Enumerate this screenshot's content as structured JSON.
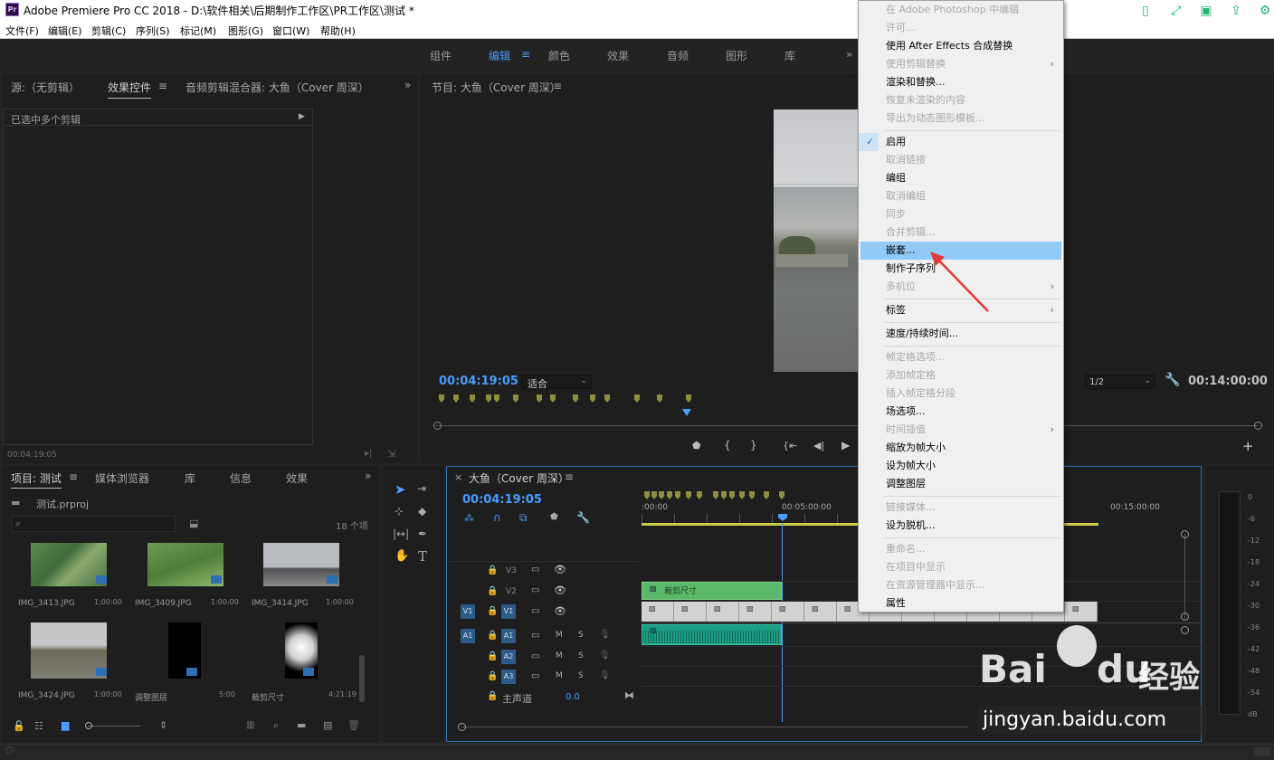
{
  "window": {
    "title": "Adobe Premiere Pro CC 2018 - D:\\软件相关\\后期制作工作区\\PR工作区\\测试 *",
    "logo": "Pr"
  },
  "menubar": [
    "文件(F)",
    "编辑(E)",
    "剪辑(C)",
    "序列(S)",
    "标记(M)",
    "图形(G)",
    "窗口(W)",
    "帮助(H)"
  ],
  "workspaces": [
    "组件",
    "编辑",
    "颜色",
    "效果",
    "音频",
    "图形",
    "库"
  ],
  "source_panel": {
    "tabs": [
      "源:（无剪辑）",
      "效果控件",
      "音频剪辑混合器: 大鱼（Cover 周深）"
    ],
    "selection_label": "已选中多个剪辑",
    "timecode": "00:04:19:05"
  },
  "program": {
    "title": "节目: 大鱼（Cover 周深）",
    "timecode": "00:04:19:05",
    "fit": "适合",
    "resolution": "1/2",
    "duration": "00:14:00:00"
  },
  "project": {
    "tabs": [
      "项目: 测试",
      "媒体浏览器",
      "库",
      "信息",
      "效果"
    ],
    "file": "测试.prproj",
    "count": "18 个项",
    "items": [
      {
        "name": "IMG_3413.JPG",
        "dur": "1:00:00"
      },
      {
        "name": "IMG_3409.JPG",
        "dur": "1:00:00"
      },
      {
        "name": "IMG_3414.JPG",
        "dur": "1:00:00"
      },
      {
        "name": "IMG_3424.JPG",
        "dur": "1:00:00"
      },
      {
        "name": "调整图层",
        "dur": "5:00"
      },
      {
        "name": "裁剪尺寸",
        "dur": "4:21:19"
      }
    ]
  },
  "timeline": {
    "title": "大鱼（Cover 周深）",
    "timecode": "00:04:19:05",
    "ruler": [
      ":00:00",
      "00:05:00:00",
      "00:15:00:00"
    ],
    "tracks": {
      "v3": "V3",
      "v2": "V2",
      "v1": "V1",
      "a1": "A1",
      "a2": "A2",
      "a3": "A3",
      "src_v": "V1",
      "src_a": "A1"
    },
    "master": "主声道",
    "master_val": "0.0",
    "clip_v2": "裁剪尺寸",
    "m": "M",
    "s": "S"
  },
  "meter": [
    "0",
    "-6",
    "-12",
    "-18",
    "-24",
    "-30",
    "-36",
    "-42",
    "-48",
    "-54",
    "dB"
  ],
  "context_menu": [
    {
      "label": "在 Adobe Photoshop 中编辑",
      "dis": true
    },
    {
      "label": "许可...",
      "dis": true
    },
    {
      "label": "使用 After Effects 合成替换",
      "dis": false
    },
    {
      "label": "使用剪辑替换",
      "dis": true,
      "sub": true
    },
    {
      "label": "渲染和替换...",
      "dis": false
    },
    {
      "label": "恢复未渲染的内容",
      "dis": true
    },
    {
      "label": "导出为动态图形模板...",
      "dis": true
    },
    {
      "label": "启用",
      "dis": false,
      "check": true
    },
    {
      "label": "取消链接",
      "dis": true
    },
    {
      "label": "编组",
      "dis": false
    },
    {
      "label": "取消编组",
      "dis": true
    },
    {
      "label": "同步",
      "dis": true
    },
    {
      "label": "合并剪辑...",
      "dis": true
    },
    {
      "label": "嵌套...",
      "dis": false,
      "hl": true
    },
    {
      "label": "制作子序列",
      "dis": false
    },
    {
      "label": "多机位",
      "dis": true,
      "sub": true
    },
    {
      "label": "标签",
      "dis": false,
      "sub": true
    },
    {
      "label": "速度/持续时间...",
      "dis": false
    },
    {
      "label": "帧定格选项...",
      "dis": true
    },
    {
      "label": "添加帧定格",
      "dis": true
    },
    {
      "label": "插入帧定格分段",
      "dis": true
    },
    {
      "label": "场选项...",
      "dis": false
    },
    {
      "label": "时间插值",
      "dis": true,
      "sub": true
    },
    {
      "label": "缩放为帧大小",
      "dis": false
    },
    {
      "label": "设为帧大小",
      "dis": false
    },
    {
      "label": "调整图层",
      "dis": false
    },
    {
      "label": "链接媒体...",
      "dis": true
    },
    {
      "label": "设为脱机...",
      "dis": false
    },
    {
      "label": "重命名...",
      "dis": true
    },
    {
      "label": "在项目中显示",
      "dis": true
    },
    {
      "label": "在资源管理器中显示...",
      "dis": true
    },
    {
      "label": "属性",
      "dis": false
    }
  ],
  "watermark": {
    "brand": "Bai",
    "brand2": "du",
    "cn": "经验",
    "url": "jingyan.baidu.com"
  },
  "colors": {
    "accent": "#4b9cff",
    "highlight": "#91c9f7",
    "clip_green": "#59b86a",
    "audio_teal": "#1d9e84"
  }
}
